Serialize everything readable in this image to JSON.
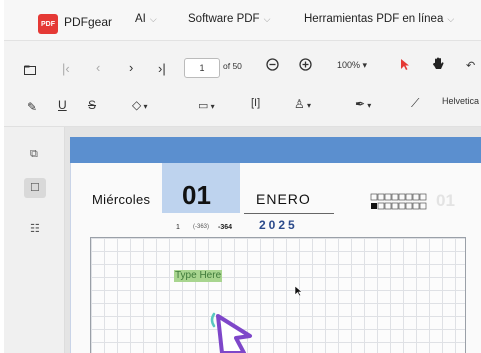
{
  "app": {
    "logo_text": "PDF",
    "brand": "PDFgear",
    "nav": [
      {
        "label": "AI"
      },
      {
        "label": "Software PDF"
      },
      {
        "label": "Herramientas PDF en línea"
      }
    ]
  },
  "toolbar": {
    "current_page": "1",
    "page_total": "of 50",
    "zoom": "100%",
    "font": "Helvetica"
  },
  "icons": {
    "chevron": "chevron-down-icon",
    "first": "first-page-icon",
    "prev": "prev-page-icon",
    "next": "next-page-icon",
    "last": "last-page-icon"
  },
  "document": {
    "weekday": "Miércoles",
    "day": "01",
    "month": "ENERO",
    "year": "2025",
    "day_of_year": "1",
    "remaining_paren": "(-363)",
    "remaining": "-364",
    "watermark_number": "01",
    "text_field": "Type Here"
  },
  "colors": {
    "accent_red": "#e53935",
    "band_blue": "#5b8fcf",
    "day_block": "#bed3ee",
    "year_blue": "#2b4a8b",
    "highlight_green": "#a8d58f"
  }
}
